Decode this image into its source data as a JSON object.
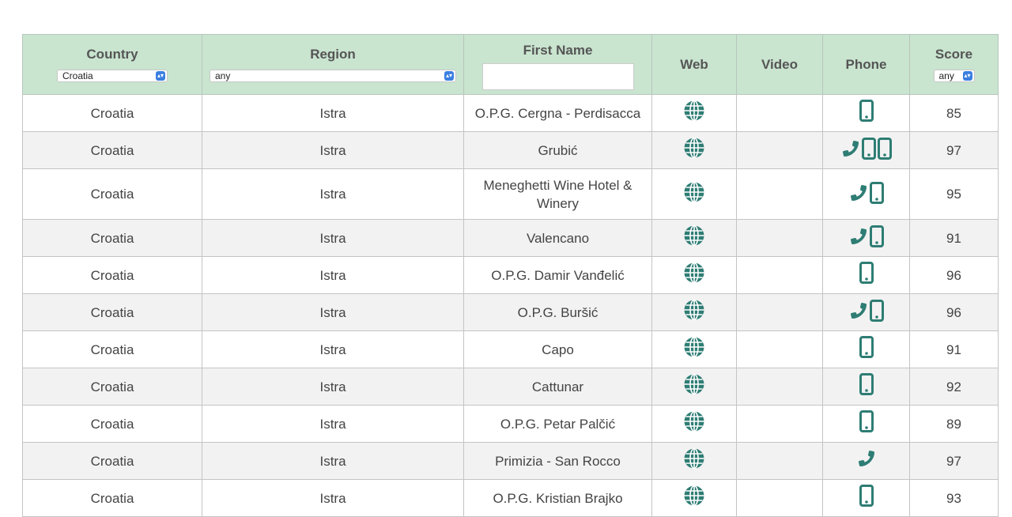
{
  "colors": {
    "header_bg": "#c9e4cf",
    "icon": "#2e7d74",
    "alt_row": "#f2f2f2"
  },
  "headers": {
    "country": "Country",
    "region": "Region",
    "first_name": "First Name",
    "web": "Web",
    "video": "Video",
    "phone": "Phone",
    "score": "Score"
  },
  "filters": {
    "country": "Croatia",
    "region": "any",
    "first_name": "",
    "score": "any"
  },
  "rows": [
    {
      "country": "Croatia",
      "region": "Istra",
      "name": "O.P.G. Cergna - Perdisacca",
      "web": "globe-icon",
      "phone": [
        "mobile"
      ],
      "score": "85"
    },
    {
      "country": "Croatia",
      "region": "Istra",
      "name": "Grubić",
      "web": "globe-icon",
      "phone": [
        "landline",
        "mobile",
        "mobile"
      ],
      "score": "97"
    },
    {
      "country": "Croatia",
      "region": "Istra",
      "name": "Meneghetti Wine Hotel & Winery",
      "web": "globe-icon",
      "phone": [
        "landline",
        "mobile"
      ],
      "score": "95"
    },
    {
      "country": "Croatia",
      "region": "Istra",
      "name": "Valencano",
      "web": "globe-icon",
      "phone": [
        "landline",
        "mobile"
      ],
      "score": "91"
    },
    {
      "country": "Croatia",
      "region": "Istra",
      "name": "O.P.G. Damir Vanđelić",
      "web": "globe-icon",
      "phone": [
        "mobile"
      ],
      "score": "96"
    },
    {
      "country": "Croatia",
      "region": "Istra",
      "name": "O.P.G. Buršić",
      "web": "globe-icon",
      "phone": [
        "landline",
        "mobile"
      ],
      "score": "96"
    },
    {
      "country": "Croatia",
      "region": "Istra",
      "name": "Capo",
      "web": "globe-icon",
      "phone": [
        "mobile"
      ],
      "score": "91"
    },
    {
      "country": "Croatia",
      "region": "Istra",
      "name": "Cattunar",
      "web": "globe-icon",
      "phone": [
        "mobile"
      ],
      "score": "92"
    },
    {
      "country": "Croatia",
      "region": "Istra",
      "name": "O.P.G. Petar Palčić",
      "web": "globe-icon",
      "phone": [
        "mobile"
      ],
      "score": "89"
    },
    {
      "country": "Croatia",
      "region": "Istra",
      "name": "Primizia - San Rocco",
      "web": "globe-icon",
      "phone": [
        "landline"
      ],
      "score": "97"
    },
    {
      "country": "Croatia",
      "region": "Istra",
      "name": "O.P.G. Kristian Brajko",
      "web": "globe-icon",
      "phone": [
        "mobile"
      ],
      "score": "93"
    }
  ]
}
